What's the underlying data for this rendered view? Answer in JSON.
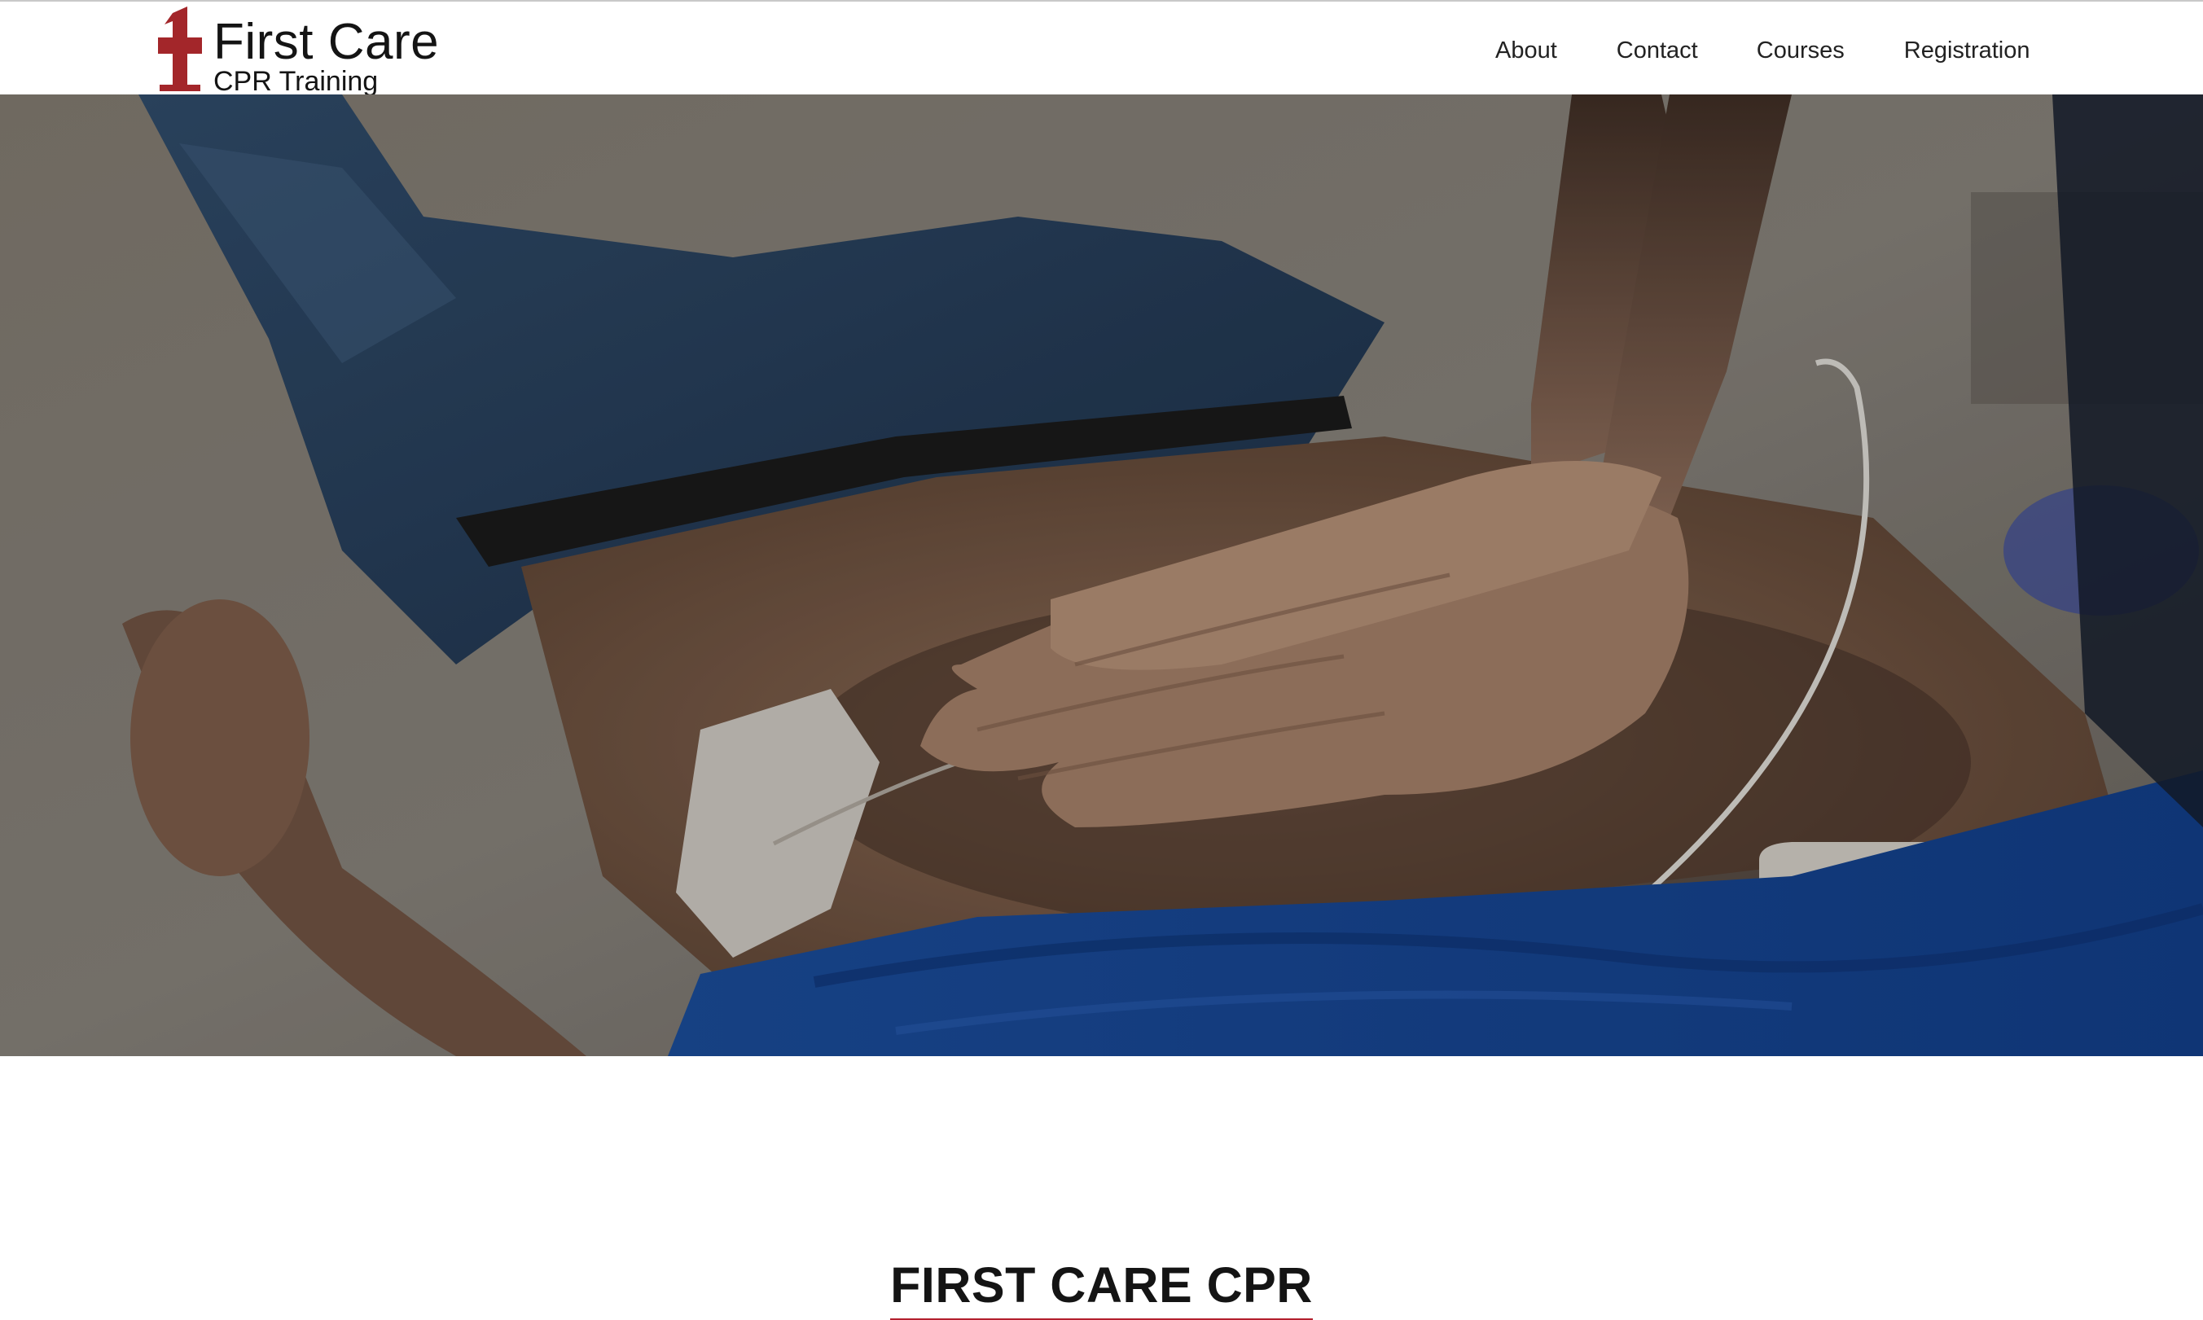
{
  "brand": {
    "title": "First Care",
    "subtitle": "CPR Training",
    "logo_icon": "medical-cross-one-icon",
    "accent_color": "#a3262a"
  },
  "nav": {
    "items": [
      {
        "label": "About"
      },
      {
        "label": "Contact"
      },
      {
        "label": "Courses"
      },
      {
        "label": "Registration"
      }
    ]
  },
  "hero": {
    "image_subject": "hands-performing-cpr-chest-compressions"
  },
  "section": {
    "title": "FIRST CARE CPR",
    "underline_color": "#b3202e"
  }
}
